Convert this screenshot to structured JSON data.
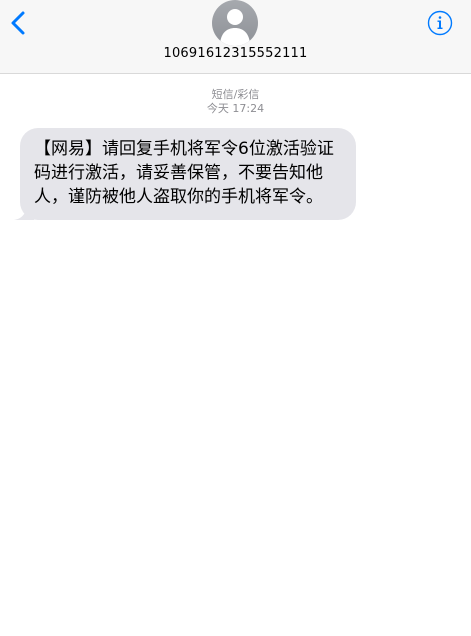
{
  "header": {
    "contact_name": "10691612315552111",
    "back_icon": "chevron-left-icon",
    "info_icon": "info-circle-icon",
    "avatar_icon": "person-silhouette-icon"
  },
  "thread": {
    "service_label": "短信/彩信",
    "timestamp": "今天 17:24"
  },
  "messages": [
    {
      "direction": "incoming",
      "text": "【网易】请回复手机将军令6位激活验证码进行激活，请妥善保管，不要告知他人，谨防被他人盗取你的手机将军令。"
    }
  ],
  "colors": {
    "accent": "#007aff",
    "bubble_incoming": "#e5e5ea",
    "header_bg": "#f7f7f7",
    "meta_text": "#8e8e93"
  }
}
